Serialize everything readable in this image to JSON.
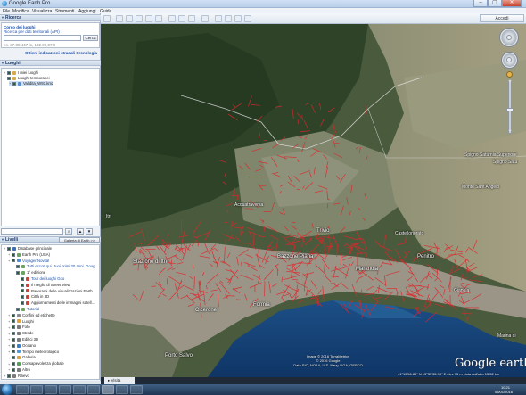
{
  "window": {
    "title": "Google Earth Pro",
    "controls": [
      "–",
      "▢",
      "✕"
    ]
  },
  "menu": [
    "File",
    "Modifica",
    "Visualizza",
    "Strumenti",
    "Aggiungi",
    "Guida"
  ],
  "toolbar": {
    "signin_label": "Accedi"
  },
  "search": {
    "header": "Ricerca",
    "result_title": "Corso dei luoghi",
    "result_subtitle": "Ricerca per dati territoriali (API)",
    "button": "Cerca",
    "hint": "es. 37.00,447 lo, 122.00,07.9",
    "links": "Ottieni indicazioni stradali  Cronologia"
  },
  "places": {
    "header": "Luoghi",
    "items": [
      {
        "label": "I miei luoghi",
        "icon_color": "#d8a94a"
      },
      {
        "label": "Luoghi temporanei",
        "icon_color": "#d8a94a"
      },
      {
        "label": "Validita_W93.kmz",
        "icon_color": "#5a8fd0",
        "selected": true
      }
    ]
  },
  "layers": {
    "header": "Livelli",
    "gallery_label": "Galleria di Earth >>",
    "items": [
      {
        "label": "Database principale",
        "level": 0,
        "icon_color": "#3b6fb7"
      },
      {
        "label": "Earth Pro (USA)",
        "level": 1,
        "icon_color": "#6aa35f"
      },
      {
        "label": "Voyager Novità!",
        "level": 1,
        "icon_color": "#4c8fd6",
        "link": true
      },
      {
        "label": "Tutti eccoti qui i tuoi primi 20 anni. Goog",
        "level": 2,
        "icon_color": "#6aa35f",
        "link": true
      },
      {
        "label": "1° edizione",
        "level": 2,
        "icon_color": "#6aa35f"
      },
      {
        "label": "Tour dei luoghi Goo",
        "level": 3,
        "icon_color": "#c9443a",
        "link": true
      },
      {
        "label": "Il meglio di Street View",
        "level": 3,
        "icon_color": "#c9443a"
      },
      {
        "label": "Panorami delle visualizzazioni Earth",
        "level": 3,
        "icon_color": "#c9443a"
      },
      {
        "label": "Città in 3D",
        "level": 3,
        "icon_color": "#c9443a"
      },
      {
        "label": "Aggiornamenti delle immagini satell...",
        "level": 3,
        "icon_color": "#c9443a"
      },
      {
        "label": "Tutorial",
        "level": 2,
        "icon_color": "#6aa35f",
        "link": true
      },
      {
        "label": "Confini ed etichette",
        "level": 1,
        "icon_color": "#8a8a8a"
      },
      {
        "label": "Luoghi",
        "level": 1,
        "icon_color": "#e0a43a"
      },
      {
        "label": "Foto",
        "level": 1,
        "icon_color": "#7a7a7a"
      },
      {
        "label": "Strade",
        "level": 1,
        "icon_color": "#7a7a7a"
      },
      {
        "label": "Edifici 3D",
        "level": 1,
        "icon_color": "#7a7a7a"
      },
      {
        "label": "Oceano",
        "level": 1,
        "icon_color": "#3b7fc4"
      },
      {
        "label": "Tempo meteorologico",
        "level": 1,
        "icon_color": "#4d9ad9"
      },
      {
        "label": "Galleria",
        "level": 1,
        "icon_color": "#d7a33b"
      },
      {
        "label": "Consapevolezza globale",
        "level": 1,
        "icon_color": "#54a155"
      },
      {
        "label": "Altro",
        "level": 1,
        "icon_color": "#7a7a7a"
      },
      {
        "label": "Rilievo",
        "level": 0,
        "icon_color": "#7a7a7a"
      }
    ]
  },
  "map": {
    "place_labels": [
      {
        "text": "Itri",
        "kind": "normal"
      },
      {
        "text": "Trivio",
        "kind": "normal"
      },
      {
        "text": "Bazzone Piana",
        "kind": "normal"
      },
      {
        "text": "Stazione di Itri",
        "kind": "normal"
      },
      {
        "text": "Maranola",
        "kind": "normal"
      },
      {
        "text": "Penitro",
        "kind": "normal"
      },
      {
        "text": "Formia",
        "kind": "normal"
      },
      {
        "text": "Gianola",
        "kind": "normal"
      },
      {
        "text": "Castellonorato",
        "kind": "normal"
      },
      {
        "text": "Acquatraversa",
        "kind": "normal"
      },
      {
        "text": "Marina di",
        "kind": "normal"
      },
      {
        "text": "Spigno Saturnia Superiore",
        "kind": "normal"
      },
      {
        "text": "Spigno Satu",
        "kind": "normal"
      },
      {
        "text": "Monte Sant'Angelo",
        "kind": "normal"
      },
      {
        "text": "Cicerone",
        "kind": "normal"
      },
      {
        "text": "Porto Salvo",
        "kind": "normal"
      }
    ],
    "credits_line1": "Image © 2016 TerraMetrics",
    "credits_line2": "© 2016 Google",
    "credits_line3": "Data SIO, NOAA, U.S. Navy, NGA, GEBCO",
    "watermark": "Google earth",
    "coords": "41°15'56.85\" N  13°35'55.99\" E  elev  15 m    vista dall'alto  15.52 km"
  },
  "status": {
    "tab_label": "Visita guidata"
  },
  "taskbar": {
    "time": "10:21",
    "date": "05/01/2016"
  }
}
